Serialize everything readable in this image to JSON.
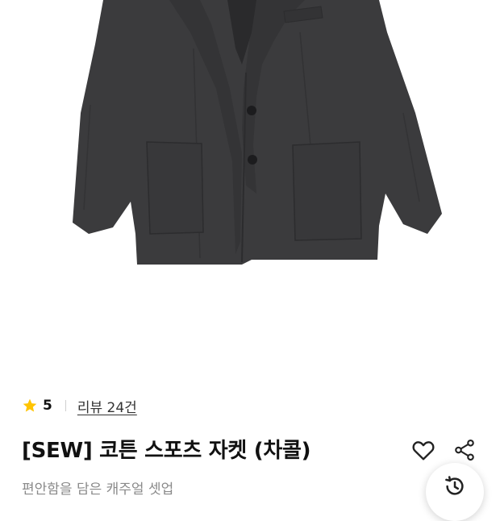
{
  "product": {
    "image_icon": "charcoal-cotton-sports-jacket-photo",
    "rating": {
      "icon": "star-icon",
      "value": "5",
      "review_link": "리뷰 24건"
    },
    "title": "[SEW] 코튼 스포츠 자켓 (차콜)",
    "subtitle": "편안함을 담은 캐주얼 셋업"
  },
  "actions": {
    "like_icon": "heart-icon",
    "share_icon": "share-icon",
    "history_icon": "history-icon"
  },
  "colors": {
    "star": "#FFC400",
    "jacket": "#3b3b3d",
    "title": "#111111",
    "subtitle": "#8a8a8a"
  }
}
